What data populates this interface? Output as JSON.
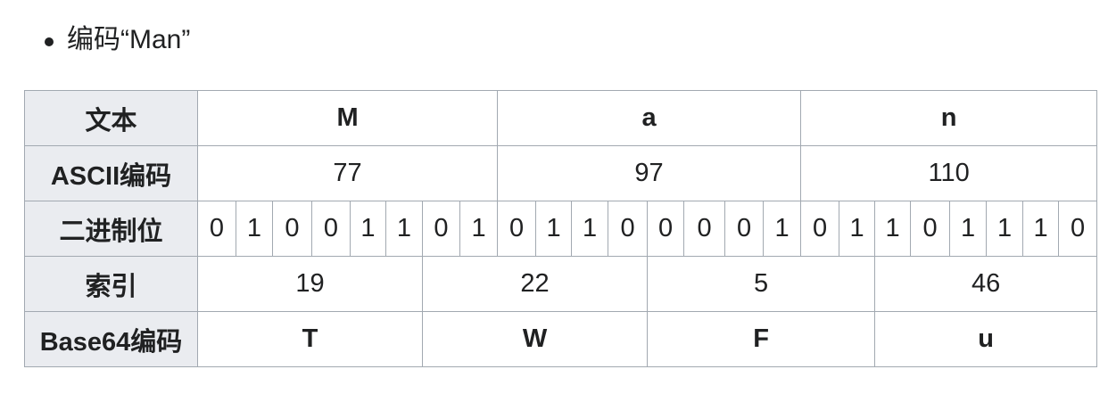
{
  "bullet": {
    "text": "编码“Man”"
  },
  "table": {
    "row_headers": {
      "text": "文本",
      "ascii": "ASCII编码",
      "bits": "二进制位",
      "index": "索引",
      "base64": "Base64编码"
    },
    "text": [
      "M",
      "a",
      "n"
    ],
    "ascii": [
      "77",
      "97",
      "110"
    ],
    "bits": [
      "0",
      "1",
      "0",
      "0",
      "1",
      "1",
      "0",
      "1",
      "0",
      "1",
      "1",
      "0",
      "0",
      "0",
      "0",
      "1",
      "0",
      "1",
      "1",
      "0",
      "1",
      "1",
      "1",
      "0"
    ],
    "index": [
      "19",
      "22",
      "5",
      "46"
    ],
    "base64": [
      "T",
      "W",
      "F",
      "u"
    ]
  },
  "colors": {
    "header_bg": "#eaecf0",
    "border": "#a2a9b1",
    "text": "#202122"
  }
}
